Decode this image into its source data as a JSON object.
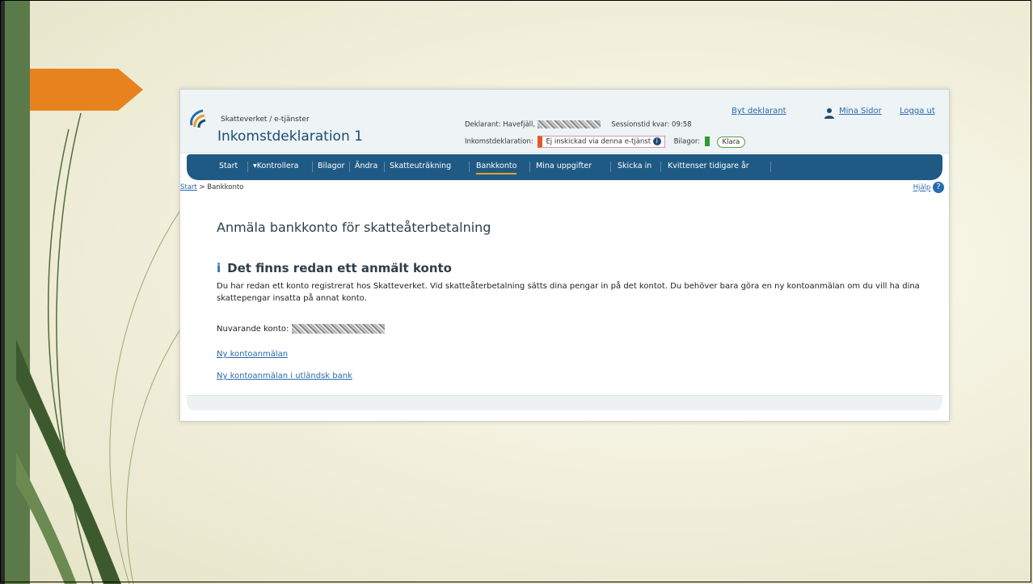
{
  "header": {
    "breadcrumb_top": "Skatteverket / e-tjänster",
    "title": "Inkomstdeklaration 1",
    "deklarant_label": "Deklarant: Havefjäll,",
    "session_label": "Sessionstid kvar: 09:58",
    "inkomst_label": "Inkomstdeklaration:",
    "status_text": "Ej inskickad via denna e-tjänst",
    "bilagor_label": "Bilagor:",
    "bilagor_status": "Klara"
  },
  "toplinks": {
    "byt": "Byt deklarant",
    "mina": "Mina Sidor",
    "logga": "Logga ut"
  },
  "nav": {
    "items": [
      "Start",
      "▾Kontrollera",
      "Bilagor",
      "Ändra",
      "Skatteuträkning",
      "Bankkonto",
      "Mina uppgifter",
      "Skicka in",
      "Kvittenser tidigare år"
    ],
    "active": "Bankkonto"
  },
  "breadcrumb": {
    "start": "Start",
    "sep": ">",
    "current": "Bankkonto",
    "help": "Hjälp"
  },
  "main": {
    "heading": "Anmäla bankkonto för skatteåterbetalning",
    "notice_title": "Det finns redan ett anmält konto",
    "notice_body": "Du har redan ett konto registrerat hos Skatteverket. Vid skatteåterbetalning sätts dina pengar in på det kontot. Du behöver bara göra en ny kontoanmälan om du vill ha dina skattepengar insatta på annat konto.",
    "current_label": "Nuvarande konto:",
    "link_new": "Ny kontoanmälan",
    "link_foreign": "Ny kontoanmälan i utländsk bank"
  },
  "colors": {
    "nav": "#1f5a85",
    "accent_orange": "#e8821f",
    "slide_green": "#5b7a49",
    "link": "#2a6aad"
  }
}
